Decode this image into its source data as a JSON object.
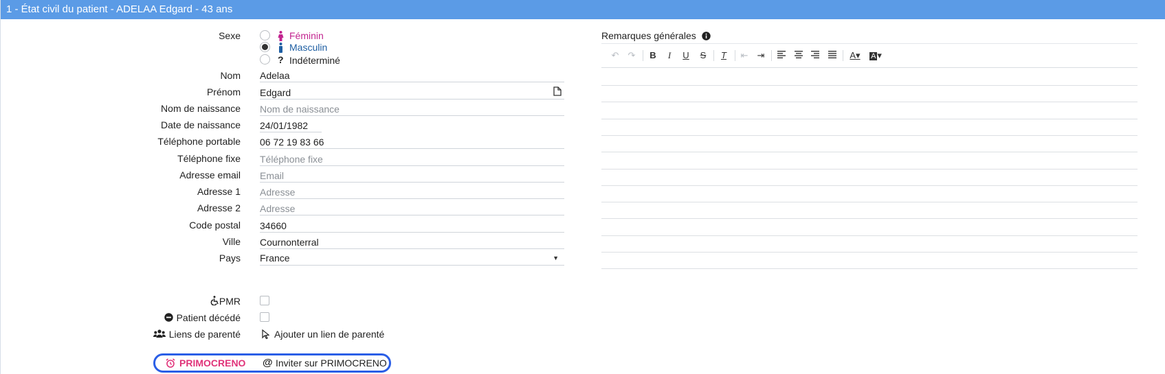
{
  "header": {
    "title": "1 - État civil du patient - ADELAA Edgard - 43 ans"
  },
  "sexe": {
    "label": "Sexe",
    "options": [
      {
        "label": "Féminin",
        "color": "#c2248f",
        "checked": false
      },
      {
        "label": "Masculin",
        "color": "#1f5fa3",
        "checked": true
      },
      {
        "label": "Indéterminé",
        "color": "#222222",
        "checked": false
      }
    ]
  },
  "fields": {
    "nom": {
      "label": "Nom",
      "value": "Adelaa",
      "placeholder": ""
    },
    "prenom": {
      "label": "Prénom",
      "value": "Edgard",
      "placeholder": ""
    },
    "nom_naissance": {
      "label": "Nom de naissance",
      "value": "",
      "placeholder": "Nom de naissance"
    },
    "date_naissance": {
      "label": "Date de naissance",
      "value": "24/01/1982",
      "placeholder": ""
    },
    "tel_portable": {
      "label": "Téléphone portable",
      "value": "06 72 19 83 66",
      "placeholder": ""
    },
    "tel_fixe": {
      "label": "Téléphone fixe",
      "value": "",
      "placeholder": "Téléphone fixe"
    },
    "email": {
      "label": "Adresse email",
      "value": "",
      "placeholder": "Email"
    },
    "adresse1": {
      "label": "Adresse 1",
      "value": "",
      "placeholder": "Adresse"
    },
    "adresse2": {
      "label": "Adresse 2",
      "value": "",
      "placeholder": "Adresse"
    },
    "code_postal": {
      "label": "Code postal",
      "value": "34660",
      "placeholder": ""
    },
    "ville": {
      "label": "Ville",
      "value": "Cournonterral",
      "placeholder": ""
    },
    "pays": {
      "label": "Pays",
      "value": "France"
    }
  },
  "flags": {
    "pmr": {
      "label": "PMR",
      "checked": false
    },
    "decede": {
      "label": "Patient décédé",
      "checked": false
    },
    "parente": {
      "label": "Liens de parenté",
      "action": "Ajouter un lien de parenté"
    }
  },
  "primocreno": {
    "brand": "PRIMOCRENO",
    "brand_color": "#e0337a",
    "invite": "Inviter sur PRIMOCRENO",
    "border_color": "#2a5ee6"
  },
  "remarques": {
    "title": "Remarques générales",
    "toolbar": [
      "undo-icon",
      "redo-icon",
      "bold-icon",
      "italic-icon",
      "underline-icon",
      "strikethrough-icon",
      "clear-format-icon",
      "outdent-icon",
      "indent-icon",
      "align-left-icon",
      "align-center-icon",
      "align-right-icon",
      "justify-icon",
      "text-color-icon",
      "background-color-icon"
    ]
  },
  "colors": {
    "header_bg": "#5b9be6",
    "accent": "#2a5ee6"
  }
}
